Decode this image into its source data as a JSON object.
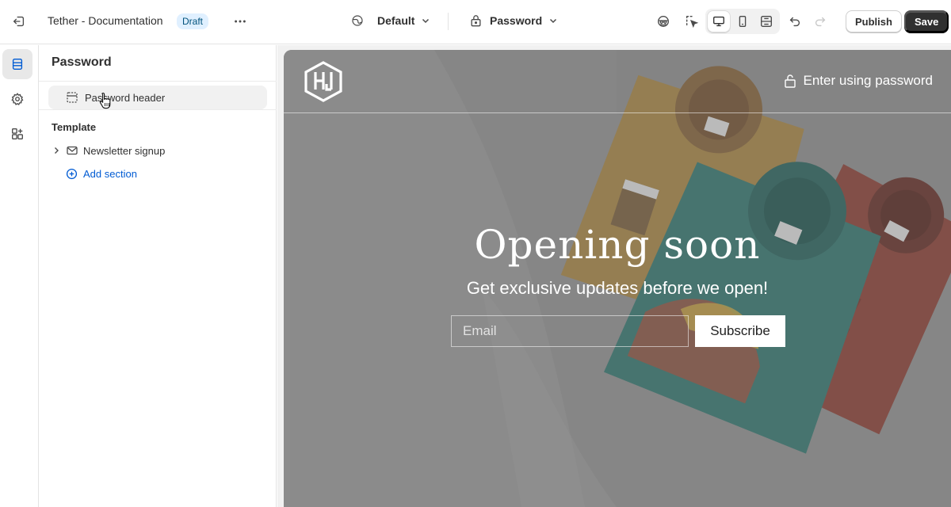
{
  "topbar": {
    "store_name": "Tether - Documentation",
    "badge": "Draft",
    "theme_dropdown": "Default",
    "page_dropdown": "Password",
    "publish_label": "Publish",
    "save_label": "Save",
    "device_selected": "desktop"
  },
  "rail": {
    "items": [
      {
        "icon": "sections-icon",
        "active": true
      },
      {
        "icon": "settings-gear-icon",
        "active": false
      },
      {
        "icon": "apps-icon",
        "active": false
      }
    ]
  },
  "sidebar": {
    "title": "Password",
    "header_section": "Password header",
    "template_heading": "Template",
    "template_items": [
      "Newsletter signup"
    ],
    "add_section_label": "Add section"
  },
  "preview": {
    "header_link": "Enter using password",
    "heading": "Opening soon",
    "subheading": "Get exclusive updates before we open!",
    "email_placeholder": "Email",
    "subscribe_label": "Subscribe"
  },
  "colors": {
    "accent_link": "#005bd3",
    "badge_bg": "#e0f0ff",
    "save_bg": "#303030",
    "preview_overlay": "#8a8a8a"
  }
}
